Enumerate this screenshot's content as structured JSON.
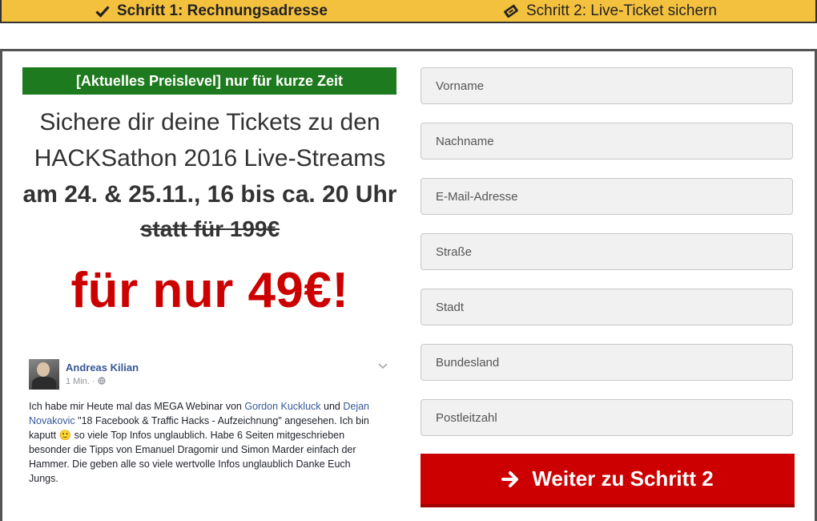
{
  "steps": {
    "step1_label": "Schritt 1: Rechnungsadresse",
    "step2_label": "Schritt 2: Live-Ticket sichern"
  },
  "offer": {
    "promo_banner": "[Aktuelles Preislevel] nur für kurze Zeit",
    "headline_line1": "Sichere dir deine Tickets zu den",
    "headline_line2": "HACKSathon 2016 Live-Streams",
    "headline_line3": "am 24. & 25.11., 16 bis ca. 20 Uhr",
    "old_price": "statt für 199€",
    "new_price": "für nur 49€!"
  },
  "testimonial": {
    "author": "Andreas Kilian",
    "time": "1 Min. · ",
    "text_1": "Ich habe mir Heute mal das MEGA Webinar von ",
    "mention_1": "Gordon Kuckluck",
    "text_2": " und ",
    "mention_2": "Dejan Novakovic",
    "text_3": " \"18 Facebook & Traffic Hacks - Aufzeichnung\" angesehen. Ich bin kaputt ",
    "emoji": "🙂",
    "text_4": " so viele Top Infos unglaublich. Habe 6 Seiten mitgeschrieben besonder die Tipps von Emanuel Dragomir und Simon Marder einfach der Hammer. Die geben alle so viele wertvolle Infos unglaublich Danke Euch Jungs."
  },
  "form": {
    "firstname_placeholder": "Vorname",
    "lastname_placeholder": "Nachname",
    "email_placeholder": "E-Mail-Adresse",
    "street_placeholder": "Straße",
    "city_placeholder": "Stadt",
    "state_placeholder": "Bundesland",
    "zip_placeholder": "Postleitzahl",
    "submit_label": "Weiter zu Schritt 2"
  },
  "colors": {
    "step_bar": "#f4c13f",
    "promo_green": "#1e7a1e",
    "price_red": "#cc0000",
    "button_red": "#cc0000",
    "link_blue": "#365899"
  },
  "icons": {
    "step1": "check-icon",
    "step2": "ticket-icon",
    "submit": "arrow-right-icon",
    "globe": "globe-icon",
    "chevron": "chevron-down-icon"
  }
}
